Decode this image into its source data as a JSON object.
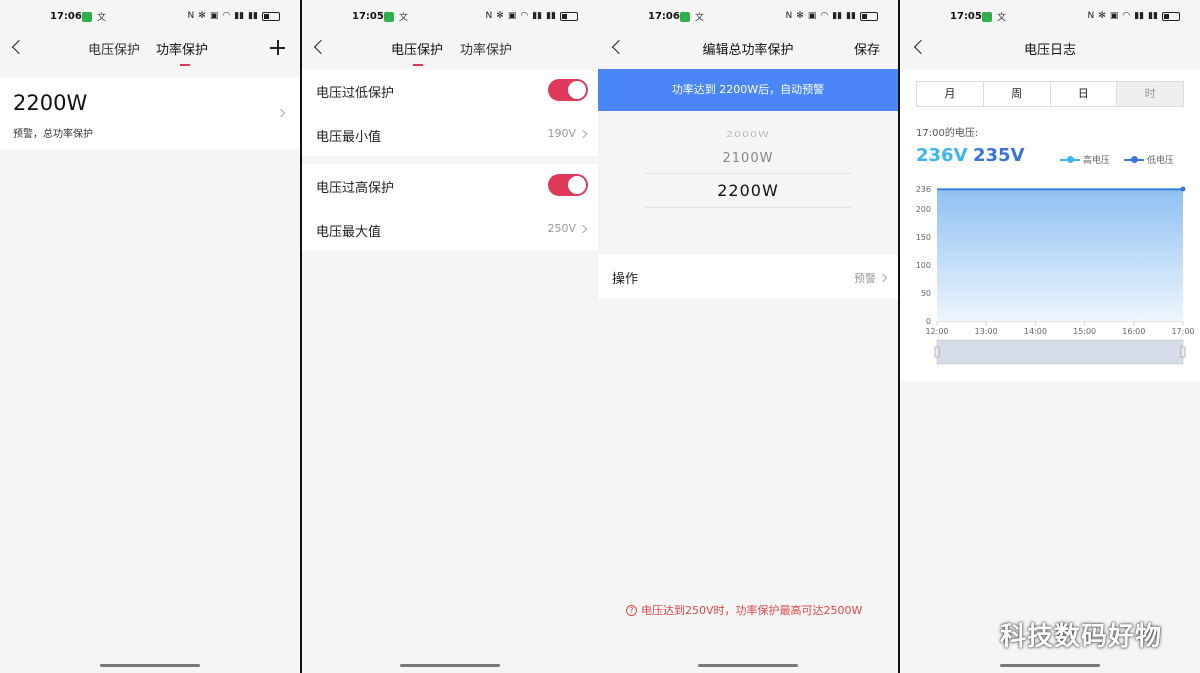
{
  "screen1": {
    "time": "17:06",
    "tabs": [
      "电压保护",
      "功率保护"
    ],
    "add_icon": "plus-icon",
    "item_title": "2200W",
    "item_sub": "预警，总功率保护"
  },
  "screen2": {
    "time": "17:05",
    "tabs": [
      "电压保护",
      "功率保护"
    ],
    "rows": [
      {
        "label": "电压过低保护",
        "type": "toggle",
        "on": true
      },
      {
        "label": "电压最小值",
        "value": "190V"
      },
      {
        "label": "电压过高保护",
        "type": "toggle",
        "on": true
      },
      {
        "label": "电压最大值",
        "value": "250V"
      }
    ]
  },
  "screen3": {
    "time": "17:06",
    "title": "编辑总功率保护",
    "save": "保存",
    "banner": "功率达到 2200W后，自动预警",
    "picker": [
      "2000W",
      "2100W",
      "2200W"
    ],
    "action_label": "操作",
    "action_value": "预警",
    "note": "电压达到250V时，功率保护最高可达2500W"
  },
  "screen4": {
    "time": "17:05",
    "title": "电压日志",
    "segments": [
      "月",
      "周",
      "日",
      "时"
    ],
    "caption": "17:00的电压:",
    "high_value": "236V",
    "low_value": "235V",
    "legend": [
      "高电压",
      "低电压"
    ]
  },
  "chart_data": {
    "type": "area",
    "x": [
      "12:00",
      "13:00",
      "14:00",
      "15:00",
      "16:00",
      "17:00"
    ],
    "y_ticks": [
      0,
      50,
      100,
      150,
      200,
      236
    ],
    "ylim": [
      0,
      236
    ],
    "series": [
      {
        "name": "高电压",
        "values": [
          236,
          236,
          236,
          236,
          236,
          236
        ]
      },
      {
        "name": "低电压",
        "values": [
          235,
          235,
          235,
          235,
          235,
          235
        ]
      }
    ],
    "legend": "top-right"
  },
  "watermark": "科技数码好物",
  "colors": {
    "accent": "#e0385a",
    "blue": "#4a86f7",
    "high": "#3cb4f0",
    "low": "#3a74d8"
  }
}
